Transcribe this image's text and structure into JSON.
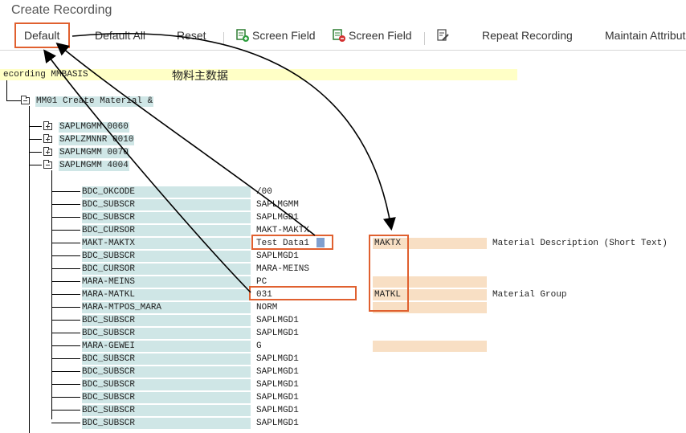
{
  "window_title": "Create Recording",
  "toolbar": {
    "default": "Default",
    "default_all": "Default All",
    "reset": "Reset",
    "screen_field_add": "Screen Field",
    "screen_field_remove": "Screen Field",
    "repeat_recording": "Repeat Recording",
    "maintain_attribute": "Maintain Attribute"
  },
  "recording_label": "ecording MMBASIS",
  "recording_desc": "物料主数据",
  "transaction": "MM01 Create Material &",
  "screens": [
    "SAPLMGMM 0060",
    "SAPLZMNNR 0010",
    "SAPLMGMM 0070",
    "SAPLMGMM 4004"
  ],
  "fields": [
    {
      "name": "BDC_OKCODE",
      "value": "/00"
    },
    {
      "name": "BDC_SUBSCR",
      "value": "SAPLMGMM"
    },
    {
      "name": "BDC_SUBSCR",
      "value": "SAPLMGD1"
    },
    {
      "name": "BDC_CURSOR",
      "value": "MAKT-MAKTX"
    },
    {
      "name": "MAKT-MAKTX",
      "value": "Test Data1",
      "ext": "MAKTX",
      "desc": "Material Description (Short Text)"
    },
    {
      "name": "BDC_SUBSCR",
      "value": "SAPLMGD1"
    },
    {
      "name": "BDC_CURSOR",
      "value": "MARA-MEINS"
    },
    {
      "name": "MARA-MEINS",
      "value": "PC"
    },
    {
      "name": "MARA-MATKL",
      "value": "031",
      "ext": "MATKL",
      "desc": "Material Group"
    },
    {
      "name": "MARA-MTPOS_MARA",
      "value": "NORM"
    },
    {
      "name": "BDC_SUBSCR",
      "value": "SAPLMGD1"
    },
    {
      "name": "BDC_SUBSCR",
      "value": "SAPLMGD1"
    },
    {
      "name": "MARA-GEWEI",
      "value": "G"
    },
    {
      "name": "BDC_SUBSCR",
      "value": "SAPLMGD1"
    },
    {
      "name": "BDC_SUBSCR",
      "value": "SAPLMGD1"
    },
    {
      "name": "BDC_SUBSCR",
      "value": "SAPLMGD1"
    },
    {
      "name": "BDC_SUBSCR",
      "value": "SAPLMGD1"
    },
    {
      "name": "BDC_SUBSCR",
      "value": "SAPLMGD1"
    },
    {
      "name": "BDC_SUBSCR",
      "value": "SAPLMGD1"
    }
  ],
  "colors": {
    "field_name_bg": "#cfe6e6",
    "external_bg": "#f8dfc4",
    "recording_bg": "#ffffc6",
    "highlight": "#e0602f"
  }
}
